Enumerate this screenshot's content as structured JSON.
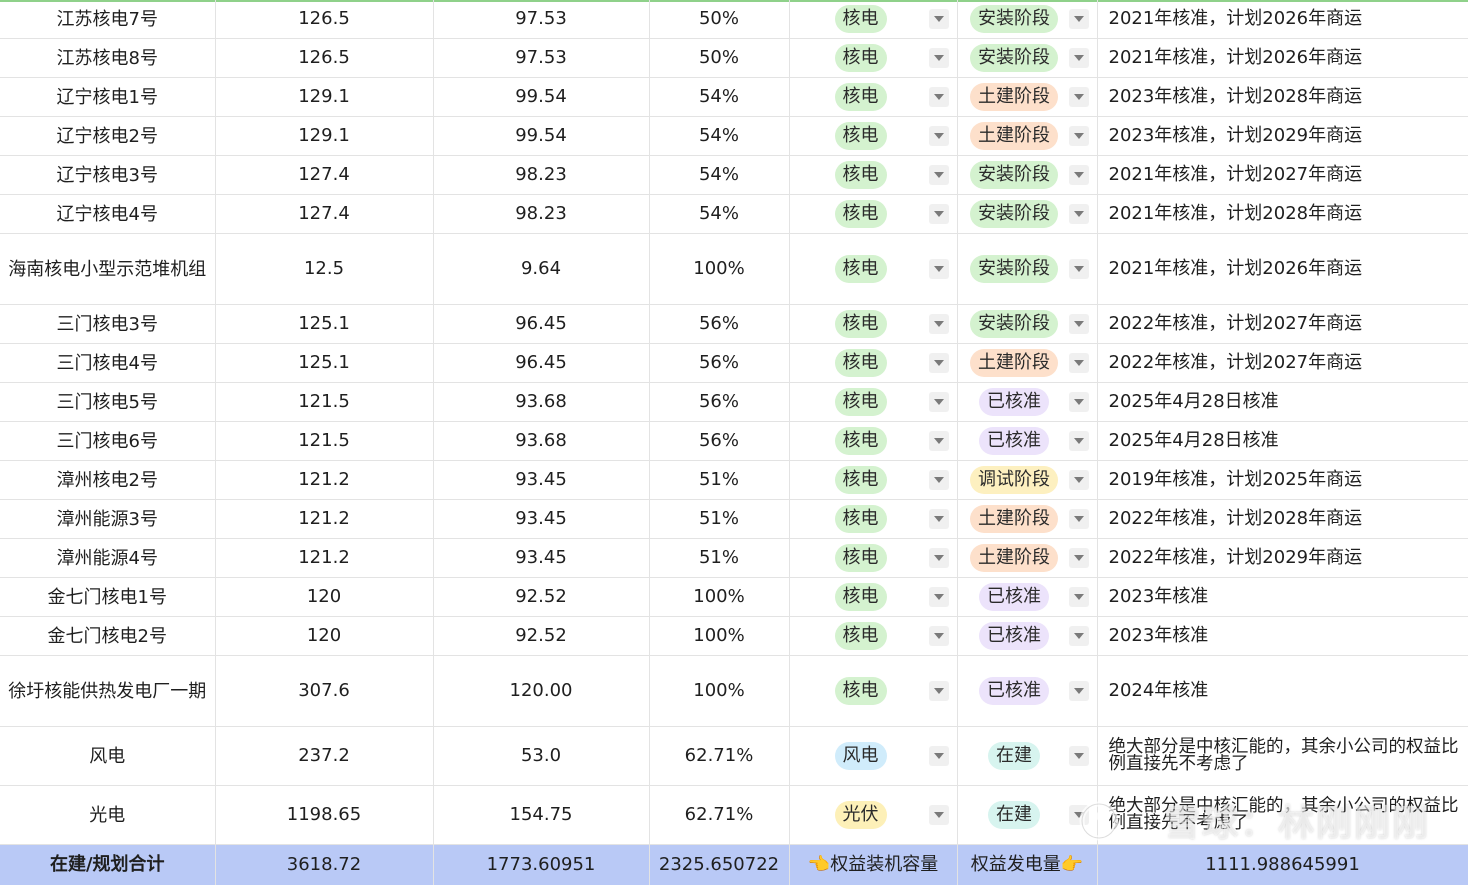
{
  "rows": [
    {
      "name": "江苏核电7号",
      "cap": "126.5",
      "eq": "97.53",
      "pct": "50%",
      "type": "核电",
      "type_style": "nuclear",
      "stage": "安装阶段",
      "stage_style": "install",
      "note": "2021年核准，计划2026年商运"
    },
    {
      "name": "江苏核电8号",
      "cap": "126.5",
      "eq": "97.53",
      "pct": "50%",
      "type": "核电",
      "type_style": "nuclear",
      "stage": "安装阶段",
      "stage_style": "install",
      "note": "2021年核准，计划2026年商运"
    },
    {
      "name": "辽宁核电1号",
      "cap": "129.1",
      "eq": "99.54",
      "pct": "54%",
      "type": "核电",
      "type_style": "nuclear",
      "stage": "土建阶段",
      "stage_style": "civil",
      "note": "2023年核准，计划2028年商运"
    },
    {
      "name": "辽宁核电2号",
      "cap": "129.1",
      "eq": "99.54",
      "pct": "54%",
      "type": "核电",
      "type_style": "nuclear",
      "stage": "土建阶段",
      "stage_style": "civil",
      "note": "2023年核准，计划2029年商运"
    },
    {
      "name": "辽宁核电3号",
      "cap": "127.4",
      "eq": "98.23",
      "pct": "54%",
      "type": "核电",
      "type_style": "nuclear",
      "stage": "安装阶段",
      "stage_style": "install",
      "note": "2021年核准，计划2027年商运"
    },
    {
      "name": "辽宁核电4号",
      "cap": "127.4",
      "eq": "98.23",
      "pct": "54%",
      "type": "核电",
      "type_style": "nuclear",
      "stage": "安装阶段",
      "stage_style": "install",
      "note": "2021年核准，计划2028年商运"
    },
    {
      "name": "海南核电小型示范堆机组",
      "cap": "12.5",
      "eq": "9.64",
      "pct": "100%",
      "type": "核电",
      "type_style": "nuclear",
      "stage": "安装阶段",
      "stage_style": "install",
      "note": "2021年核准，计划2026年商运"
    },
    {
      "name": "三门核电3号",
      "cap": "125.1",
      "eq": "96.45",
      "pct": "56%",
      "type": "核电",
      "type_style": "nuclear",
      "stage": "安装阶段",
      "stage_style": "install",
      "note": "2022年核准，计划2027年商运"
    },
    {
      "name": "三门核电4号",
      "cap": "125.1",
      "eq": "96.45",
      "pct": "56%",
      "type": "核电",
      "type_style": "nuclear",
      "stage": "土建阶段",
      "stage_style": "civil",
      "note": "2022年核准，计划2027年商运"
    },
    {
      "name": "三门核电5号",
      "cap": "121.5",
      "eq": "93.68",
      "pct": "56%",
      "type": "核电",
      "type_style": "nuclear",
      "stage": "已核准",
      "stage_style": "approved",
      "note": "2025年4月28日核准"
    },
    {
      "name": "三门核电6号",
      "cap": "121.5",
      "eq": "93.68",
      "pct": "56%",
      "type": "核电",
      "type_style": "nuclear",
      "stage": "已核准",
      "stage_style": "approved",
      "note": "2025年4月28日核准"
    },
    {
      "name": "漳州核电2号",
      "cap": "121.2",
      "eq": "93.45",
      "pct": "51%",
      "type": "核电",
      "type_style": "nuclear",
      "stage": "调试阶段",
      "stage_style": "debug",
      "note": "2019年核准，计划2025年商运"
    },
    {
      "name": "漳州能源3号",
      "cap": "121.2",
      "eq": "93.45",
      "pct": "51%",
      "type": "核电",
      "type_style": "nuclear",
      "stage": "土建阶段",
      "stage_style": "civil",
      "note": "2022年核准，计划2028年商运"
    },
    {
      "name": "漳州能源4号",
      "cap": "121.2",
      "eq": "93.45",
      "pct": "51%",
      "type": "核电",
      "type_style": "nuclear",
      "stage": "土建阶段",
      "stage_style": "civil",
      "note": "2022年核准，计划2029年商运"
    },
    {
      "name": "金七门核电1号",
      "cap": "120",
      "eq": "92.52",
      "pct": "100%",
      "type": "核电",
      "type_style": "nuclear",
      "stage": "已核准",
      "stage_style": "approved",
      "note": "2023年核准"
    },
    {
      "name": "金七门核电2号",
      "cap": "120",
      "eq": "92.52",
      "pct": "100%",
      "type": "核电",
      "type_style": "nuclear",
      "stage": "已核准",
      "stage_style": "approved",
      "note": "2023年核准"
    },
    {
      "name": "徐圩核能供热发电厂一期",
      "cap": "307.6",
      "eq": "120.00",
      "pct": "100%",
      "type": "核电",
      "type_style": "nuclear",
      "stage": "已核准",
      "stage_style": "approved",
      "note": "2024年核准"
    },
    {
      "name": "风电",
      "cap": "237.2",
      "eq": "53.0",
      "pct": "62.71%",
      "type": "风电",
      "type_style": "wind",
      "stage": "在建",
      "stage_style": "build",
      "note": "绝大部分是中核汇能的，其余小公司的权益比例直接先不考虑了"
    },
    {
      "name": "光电",
      "cap": "1198.65",
      "eq": "154.75",
      "pct": "62.71%",
      "type": "光伏",
      "type_style": "solar",
      "stage": "在建",
      "stage_style": "build",
      "note": "绝大部分是中核汇能的，其余小公司的权益比例直接先不考虑了"
    }
  ],
  "total": {
    "label": "在建/规划合计",
    "cap": "3618.72",
    "eq": "1773.60951",
    "pct": "2325.650722",
    "type_label": "👈权益装机容量",
    "stage_label": "权益发电量👉",
    "note": "1111.988645991"
  },
  "watermark": "雪球：林刚刚刚",
  "colors": {
    "total_row_bg": "#b9c9f6",
    "nuclear_tag": "#d4f2cf",
    "install_tag": "#d4f2cf",
    "civil_tag": "#fde0cb",
    "approved_tag": "#ece3fb",
    "debug_tag": "#fdf0c0",
    "build_tag": "#d7f4ef",
    "wind_tag": "#d0ecfb",
    "solar_tag": "#fdf0b8"
  },
  "icons": [
    "dropdown-arrow-icon",
    "pointing-left-hand-icon",
    "pointing-right-hand-icon",
    "snowball-logo-icon"
  ]
}
